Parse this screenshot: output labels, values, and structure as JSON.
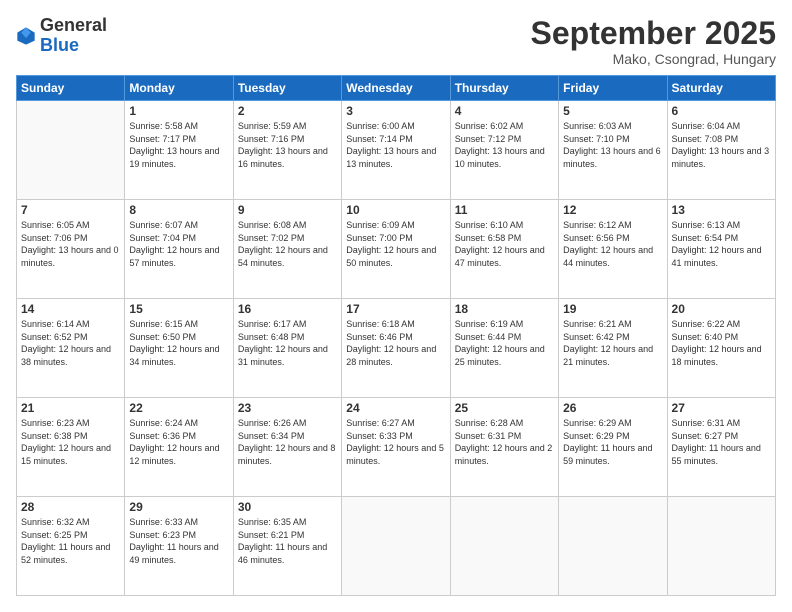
{
  "logo": {
    "line1": "General",
    "line2": "Blue"
  },
  "title": "September 2025",
  "subtitle": "Mako, Csongrad, Hungary",
  "weekdays": [
    "Sunday",
    "Monday",
    "Tuesday",
    "Wednesday",
    "Thursday",
    "Friday",
    "Saturday"
  ],
  "weeks": [
    [
      {
        "day": "",
        "sunrise": "",
        "sunset": "",
        "daylight": ""
      },
      {
        "day": "1",
        "sunrise": "Sunrise: 5:58 AM",
        "sunset": "Sunset: 7:17 PM",
        "daylight": "Daylight: 13 hours and 19 minutes."
      },
      {
        "day": "2",
        "sunrise": "Sunrise: 5:59 AM",
        "sunset": "Sunset: 7:16 PM",
        "daylight": "Daylight: 13 hours and 16 minutes."
      },
      {
        "day": "3",
        "sunrise": "Sunrise: 6:00 AM",
        "sunset": "Sunset: 7:14 PM",
        "daylight": "Daylight: 13 hours and 13 minutes."
      },
      {
        "day": "4",
        "sunrise": "Sunrise: 6:02 AM",
        "sunset": "Sunset: 7:12 PM",
        "daylight": "Daylight: 13 hours and 10 minutes."
      },
      {
        "day": "5",
        "sunrise": "Sunrise: 6:03 AM",
        "sunset": "Sunset: 7:10 PM",
        "daylight": "Daylight: 13 hours and 6 minutes."
      },
      {
        "day": "6",
        "sunrise": "Sunrise: 6:04 AM",
        "sunset": "Sunset: 7:08 PM",
        "daylight": "Daylight: 13 hours and 3 minutes."
      }
    ],
    [
      {
        "day": "7",
        "sunrise": "Sunrise: 6:05 AM",
        "sunset": "Sunset: 7:06 PM",
        "daylight": "Daylight: 13 hours and 0 minutes."
      },
      {
        "day": "8",
        "sunrise": "Sunrise: 6:07 AM",
        "sunset": "Sunset: 7:04 PM",
        "daylight": "Daylight: 12 hours and 57 minutes."
      },
      {
        "day": "9",
        "sunrise": "Sunrise: 6:08 AM",
        "sunset": "Sunset: 7:02 PM",
        "daylight": "Daylight: 12 hours and 54 minutes."
      },
      {
        "day": "10",
        "sunrise": "Sunrise: 6:09 AM",
        "sunset": "Sunset: 7:00 PM",
        "daylight": "Daylight: 12 hours and 50 minutes."
      },
      {
        "day": "11",
        "sunrise": "Sunrise: 6:10 AM",
        "sunset": "Sunset: 6:58 PM",
        "daylight": "Daylight: 12 hours and 47 minutes."
      },
      {
        "day": "12",
        "sunrise": "Sunrise: 6:12 AM",
        "sunset": "Sunset: 6:56 PM",
        "daylight": "Daylight: 12 hours and 44 minutes."
      },
      {
        "day": "13",
        "sunrise": "Sunrise: 6:13 AM",
        "sunset": "Sunset: 6:54 PM",
        "daylight": "Daylight: 12 hours and 41 minutes."
      }
    ],
    [
      {
        "day": "14",
        "sunrise": "Sunrise: 6:14 AM",
        "sunset": "Sunset: 6:52 PM",
        "daylight": "Daylight: 12 hours and 38 minutes."
      },
      {
        "day": "15",
        "sunrise": "Sunrise: 6:15 AM",
        "sunset": "Sunset: 6:50 PM",
        "daylight": "Daylight: 12 hours and 34 minutes."
      },
      {
        "day": "16",
        "sunrise": "Sunrise: 6:17 AM",
        "sunset": "Sunset: 6:48 PM",
        "daylight": "Daylight: 12 hours and 31 minutes."
      },
      {
        "day": "17",
        "sunrise": "Sunrise: 6:18 AM",
        "sunset": "Sunset: 6:46 PM",
        "daylight": "Daylight: 12 hours and 28 minutes."
      },
      {
        "day": "18",
        "sunrise": "Sunrise: 6:19 AM",
        "sunset": "Sunset: 6:44 PM",
        "daylight": "Daylight: 12 hours and 25 minutes."
      },
      {
        "day": "19",
        "sunrise": "Sunrise: 6:21 AM",
        "sunset": "Sunset: 6:42 PM",
        "daylight": "Daylight: 12 hours and 21 minutes."
      },
      {
        "day": "20",
        "sunrise": "Sunrise: 6:22 AM",
        "sunset": "Sunset: 6:40 PM",
        "daylight": "Daylight: 12 hours and 18 minutes."
      }
    ],
    [
      {
        "day": "21",
        "sunrise": "Sunrise: 6:23 AM",
        "sunset": "Sunset: 6:38 PM",
        "daylight": "Daylight: 12 hours and 15 minutes."
      },
      {
        "day": "22",
        "sunrise": "Sunrise: 6:24 AM",
        "sunset": "Sunset: 6:36 PM",
        "daylight": "Daylight: 12 hours and 12 minutes."
      },
      {
        "day": "23",
        "sunrise": "Sunrise: 6:26 AM",
        "sunset": "Sunset: 6:34 PM",
        "daylight": "Daylight: 12 hours and 8 minutes."
      },
      {
        "day": "24",
        "sunrise": "Sunrise: 6:27 AM",
        "sunset": "Sunset: 6:33 PM",
        "daylight": "Daylight: 12 hours and 5 minutes."
      },
      {
        "day": "25",
        "sunrise": "Sunrise: 6:28 AM",
        "sunset": "Sunset: 6:31 PM",
        "daylight": "Daylight: 12 hours and 2 minutes."
      },
      {
        "day": "26",
        "sunrise": "Sunrise: 6:29 AM",
        "sunset": "Sunset: 6:29 PM",
        "daylight": "Daylight: 11 hours and 59 minutes."
      },
      {
        "day": "27",
        "sunrise": "Sunrise: 6:31 AM",
        "sunset": "Sunset: 6:27 PM",
        "daylight": "Daylight: 11 hours and 55 minutes."
      }
    ],
    [
      {
        "day": "28",
        "sunrise": "Sunrise: 6:32 AM",
        "sunset": "Sunset: 6:25 PM",
        "daylight": "Daylight: 11 hours and 52 minutes."
      },
      {
        "day": "29",
        "sunrise": "Sunrise: 6:33 AM",
        "sunset": "Sunset: 6:23 PM",
        "daylight": "Daylight: 11 hours and 49 minutes."
      },
      {
        "day": "30",
        "sunrise": "Sunrise: 6:35 AM",
        "sunset": "Sunset: 6:21 PM",
        "daylight": "Daylight: 11 hours and 46 minutes."
      },
      {
        "day": "",
        "sunrise": "",
        "sunset": "",
        "daylight": ""
      },
      {
        "day": "",
        "sunrise": "",
        "sunset": "",
        "daylight": ""
      },
      {
        "day": "",
        "sunrise": "",
        "sunset": "",
        "daylight": ""
      },
      {
        "day": "",
        "sunrise": "",
        "sunset": "",
        "daylight": ""
      }
    ]
  ]
}
